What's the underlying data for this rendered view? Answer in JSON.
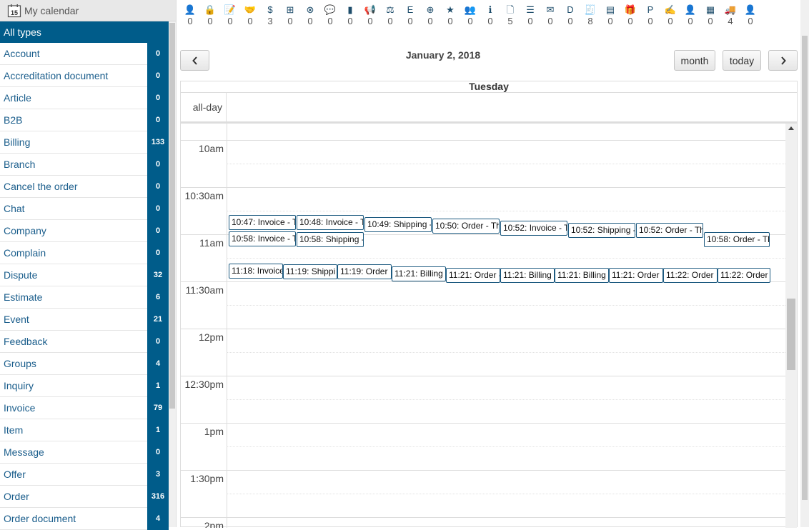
{
  "sidebar": {
    "header_title": "My calendar",
    "header_icon_text": "15",
    "all_types_label": "All types",
    "items": [
      {
        "label": "Account",
        "count": "0"
      },
      {
        "label": "Accreditation document",
        "count": "0"
      },
      {
        "label": "Article",
        "count": "0"
      },
      {
        "label": "B2B",
        "count": "0"
      },
      {
        "label": "Billing",
        "count": "133"
      },
      {
        "label": "Branch",
        "count": "0"
      },
      {
        "label": "Cancel the order",
        "count": "0"
      },
      {
        "label": "Chat",
        "count": "0"
      },
      {
        "label": "Company",
        "count": "0"
      },
      {
        "label": "Complain",
        "count": "0"
      },
      {
        "label": "Dispute",
        "count": "32"
      },
      {
        "label": "Estimate",
        "count": "6"
      },
      {
        "label": "Event",
        "count": "21"
      },
      {
        "label": "Feedback",
        "count": "0"
      },
      {
        "label": "Groups",
        "count": "4"
      },
      {
        "label": "Inquiry",
        "count": "1"
      },
      {
        "label": "Invoice",
        "count": "79"
      },
      {
        "label": "Item",
        "count": "1"
      },
      {
        "label": "Message",
        "count": "0"
      },
      {
        "label": "Offer",
        "count": "3"
      },
      {
        "label": "Order",
        "count": "316"
      },
      {
        "label": "Order document",
        "count": "4"
      }
    ]
  },
  "icon_bar": [
    {
      "icon": "user-icon",
      "glyph": "👤",
      "count": "0"
    },
    {
      "icon": "lock-icon",
      "glyph": "🔒",
      "count": "0"
    },
    {
      "icon": "document-edit-icon",
      "glyph": "📝",
      "count": "0"
    },
    {
      "icon": "handshake-icon",
      "glyph": "🤝",
      "count": "0"
    },
    {
      "icon": "dollar-icon",
      "glyph": "$",
      "count": "3"
    },
    {
      "icon": "sitemap-icon",
      "glyph": "⊞",
      "count": "0"
    },
    {
      "icon": "cancel-circle-icon",
      "glyph": "⊗",
      "count": "0"
    },
    {
      "icon": "chat-icon",
      "glyph": "💬",
      "count": "0"
    },
    {
      "icon": "building-icon",
      "glyph": "▮",
      "count": "0"
    },
    {
      "icon": "megaphone-icon",
      "glyph": "📢",
      "count": "0"
    },
    {
      "icon": "gavel-icon",
      "glyph": "⚖",
      "count": "0"
    },
    {
      "icon": "estimate-icon",
      "glyph": "E",
      "count": "0"
    },
    {
      "icon": "calendar-plus-icon",
      "glyph": "⊕",
      "count": "0"
    },
    {
      "icon": "star-icon",
      "glyph": "★",
      "count": "0"
    },
    {
      "icon": "group-icon",
      "glyph": "👥",
      "count": "0"
    },
    {
      "icon": "info-document-icon",
      "glyph": "ℹ",
      "count": "0"
    },
    {
      "icon": "file-icon",
      "glyph": "🗋",
      "count": "5"
    },
    {
      "icon": "list-icon",
      "glyph": "☰",
      "count": "0"
    },
    {
      "icon": "envelope-icon",
      "glyph": "✉",
      "count": "0"
    },
    {
      "icon": "offer-document-icon",
      "glyph": "D",
      "count": "0"
    },
    {
      "icon": "receipt-icon",
      "glyph": "🧾",
      "count": "8"
    },
    {
      "icon": "order-document-icon",
      "glyph": "▤",
      "count": "0"
    },
    {
      "icon": "gift-icon",
      "glyph": "🎁",
      "count": "0"
    },
    {
      "icon": "pdf-document-icon",
      "glyph": "P",
      "count": "0"
    },
    {
      "icon": "signed-document-icon",
      "glyph": "✍",
      "count": "0"
    },
    {
      "icon": "person-badge-icon",
      "glyph": "👤",
      "count": "0"
    },
    {
      "icon": "ledger-icon",
      "glyph": "▦",
      "count": "0"
    },
    {
      "icon": "truck-icon",
      "glyph": "🚚",
      "count": "4"
    },
    {
      "icon": "user-settings-icon",
      "glyph": "👤",
      "count": "0"
    }
  ],
  "toolbar": {
    "prev_label": "‹",
    "next_label": "›",
    "month_label": "month",
    "today_label": "today",
    "title": "January 2, 2018"
  },
  "calendar": {
    "day_header": "Tuesday",
    "allday_label": "all-day",
    "times": [
      "10am",
      "10:30am",
      "11am",
      "11:30am",
      "12pm",
      "12:30pm",
      "1pm",
      "1:30pm",
      "2pm"
    ],
    "events": [
      "10:47: Invoice - T",
      "10:48: Invoice - T",
      "10:49: Shipping -",
      "10:50: Order - Th",
      "10:52: Invoice - T",
      "10:52: Shipping -",
      "10:52: Order - Th",
      "10:58: Invoice - T",
      "10:58: Shipping -",
      "10:58: Order - Th",
      "11:18: Invoice",
      "11:19: Shippi",
      "11:19: Order",
      "11:21: Billing",
      "11:21: Order -",
      "11:21: Billing",
      "11:21: Billing",
      "11:21: Order",
      "11:22: Order",
      "11:22: Order"
    ]
  }
}
